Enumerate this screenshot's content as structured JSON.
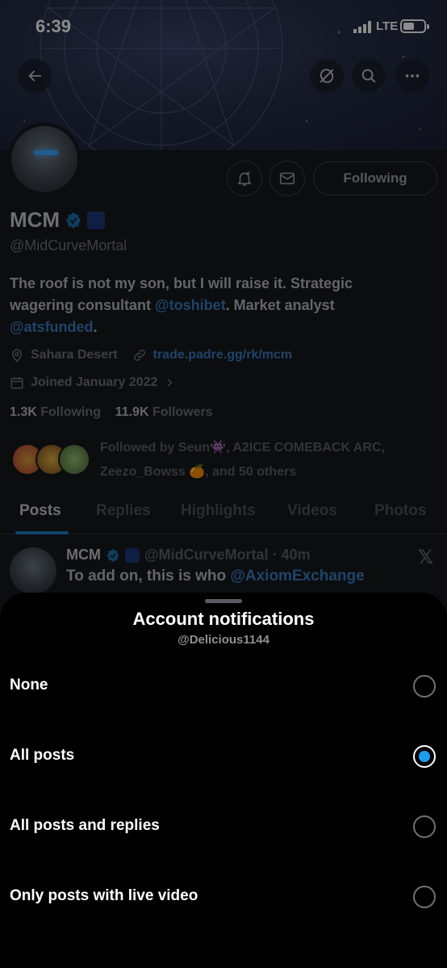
{
  "status_bar": {
    "time": "6:39",
    "network": "LTE"
  },
  "profile": {
    "following_button": "Following",
    "name": "MCM",
    "handle": "@MidCurveMortal",
    "bio": {
      "text_1": "The roof is not my son, but I will raise it. Strategic wagering consultant ",
      "link_1": "@toshibet",
      "text_2": ". Market analyst ",
      "link_2": "@atsfunded",
      "text_3": "."
    },
    "location": "Sahara Desert",
    "website": "trade.padre.gg/rk/mcm",
    "joined": "Joined January 2022",
    "following_count": "1.3K",
    "following_label": "Following",
    "followers_count": "11.9K",
    "followers_label": "Followers",
    "followed_by": {
      "prefix": "Followed by Seun",
      "emoji_1": "👾",
      "mid": ", A2ICE COMEBACK ARC, Zeezo_Bowss",
      "emoji_2": "🍊",
      "suffix": ", and 50 others"
    }
  },
  "tabs": [
    "Posts",
    "Replies",
    "Highlights",
    "Videos",
    "Photos"
  ],
  "post": {
    "author": "MCM",
    "handle_time": "@MidCurveMortal · 40m",
    "text": "To add on, this is who ",
    "mention": "@AxiomExchange",
    "x_logo": "𝕏"
  },
  "sheet": {
    "title": "Account notifications",
    "subtitle": "@Delicious1144",
    "options": [
      {
        "label": "None",
        "selected": false
      },
      {
        "label": "All posts",
        "selected": true
      },
      {
        "label": "All posts and replies",
        "selected": false
      },
      {
        "label": "Only posts with live video",
        "selected": false
      }
    ]
  },
  "colors": {
    "accent": "#1d9bf0",
    "link": "#3a7cc0",
    "sheet_bg": "#000000"
  },
  "icons": [
    "back-arrow-icon",
    "refresh-off-icon",
    "search-icon",
    "more-icon",
    "bell-plus-icon",
    "mail-icon",
    "location-icon",
    "link-icon",
    "calendar-icon",
    "verified-icon"
  ]
}
